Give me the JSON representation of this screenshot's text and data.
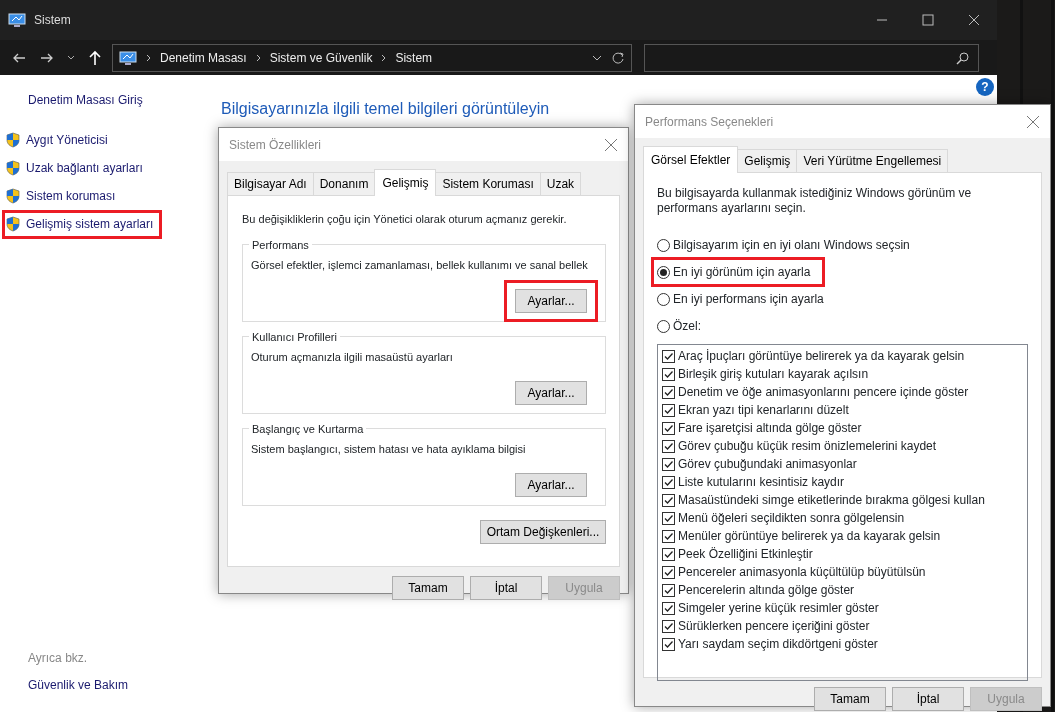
{
  "window": {
    "title": "Sistem",
    "breadcrumb": [
      "Denetim Masası",
      "Sistem ve Güvenlik",
      "Sistem"
    ],
    "help": "?"
  },
  "sidebar": {
    "home": "Denetim Masası Giriş",
    "items": [
      {
        "label": "Aygıt Yöneticisi",
        "highlighted": false
      },
      {
        "label": "Uzak bağlantı ayarları",
        "highlighted": false
      },
      {
        "label": "Sistem koruması",
        "highlighted": false
      },
      {
        "label": "Gelişmiş sistem ayarları",
        "highlighted": true
      }
    ],
    "see_also_heading": "Ayrıca bkz.",
    "see_also": [
      "Güvenlik ve Bakım"
    ]
  },
  "main": {
    "heading": "Bilgisayarınızla ilgili temel bilgileri görüntüleyin"
  },
  "system_properties": {
    "title": "Sistem Özellikleri",
    "tabs": [
      {
        "label": "Bilgisayar Adı",
        "selected": false
      },
      {
        "label": "Donanım",
        "selected": false
      },
      {
        "label": "Gelişmiş",
        "selected": true
      },
      {
        "label": "Sistem Koruması",
        "selected": false
      },
      {
        "label": "Uzak",
        "selected": false
      }
    ],
    "note": "Bu değişikliklerin çoğu için Yönetici olarak oturum açmanız gerekir.",
    "groups": [
      {
        "title": "Performans",
        "description": "Görsel efektler, işlemci zamanlaması, bellek kullanımı ve sanal bellek",
        "button": {
          "label": "Ayarlar...",
          "highlighted": true
        }
      },
      {
        "title": "Kullanıcı Profilleri",
        "description": "Oturum açmanızla ilgili masaüstü ayarları",
        "button": {
          "label": "Ayarlar...",
          "highlighted": false
        }
      },
      {
        "title": "Başlangıç ve Kurtarma",
        "description": "Sistem başlangıcı, sistem hatası ve hata ayıklama bilgisi",
        "button": {
          "label": "Ayarlar...",
          "highlighted": false
        }
      }
    ],
    "env_button": "Ortam Değişkenleri...",
    "buttons": [
      {
        "label": "Tamam",
        "disabled": false
      },
      {
        "label": "İptal",
        "disabled": false
      },
      {
        "label": "Uygula",
        "disabled": true
      }
    ]
  },
  "performance_options": {
    "title": "Performans Seçenekleri",
    "tabs": [
      {
        "label": "Görsel Efektler",
        "selected": true
      },
      {
        "label": "Gelişmiş",
        "selected": false
      },
      {
        "label": "Veri Yürütme Engellemesi",
        "selected": false
      }
    ],
    "intro": "Bu bilgisayarda kullanmak istediğiniz Windows görünüm ve performans ayarlarını seçin.",
    "options": [
      {
        "label": "Bilgisayarım için en iyi olanı Windows seçsin",
        "selected": false,
        "highlighted": false
      },
      {
        "label": "En iyi görünüm için ayarla",
        "selected": true,
        "highlighted": true
      },
      {
        "label": "En iyi performans için ayarla",
        "selected": false,
        "highlighted": false
      },
      {
        "label": "Özel:",
        "selected": false,
        "highlighted": false
      }
    ],
    "effects": [
      {
        "label": "Araç İpuçları görüntüye belirerek ya da kayarak gelsin",
        "checked": true
      },
      {
        "label": "Birleşik giriş kutuları kayarak açılsın",
        "checked": true
      },
      {
        "label": "Denetim ve öğe animasyonlarını pencere içinde göster",
        "checked": true
      },
      {
        "label": "Ekran yazı tipi kenarlarını düzelt",
        "checked": true
      },
      {
        "label": "Fare işaretçisi altında gölge göster",
        "checked": true
      },
      {
        "label": "Görev çubuğu küçük resim önizlemelerini kaydet",
        "checked": true
      },
      {
        "label": "Görev çubuğundaki animasyonlar",
        "checked": true
      },
      {
        "label": "Liste kutularını kesintisiz kaydır",
        "checked": true
      },
      {
        "label": "Masaüstündeki simge etiketlerinde bırakma gölgesi kullan",
        "checked": true
      },
      {
        "label": "Menü öğeleri seçildikten sonra gölgelensin",
        "checked": true
      },
      {
        "label": "Menüler görüntüye belirerek ya da kayarak gelsin",
        "checked": true
      },
      {
        "label": "Peek Özelliğini Etkinleştir",
        "checked": true
      },
      {
        "label": "Pencereler animasyonla küçültülüp büyütülsün",
        "checked": true
      },
      {
        "label": "Pencerelerin altında gölge göster",
        "checked": true
      },
      {
        "label": "Simgeler yerine küçük resimler göster",
        "checked": true
      },
      {
        "label": "Sürüklerken pencere içeriğini göster",
        "checked": true
      },
      {
        "label": "Yarı saydam seçim dikdörtgeni göster",
        "checked": true
      }
    ],
    "buttons": [
      {
        "label": "Tamam",
        "disabled": false
      },
      {
        "label": "İptal",
        "disabled": false
      },
      {
        "label": "Uygula",
        "disabled": true
      }
    ]
  }
}
